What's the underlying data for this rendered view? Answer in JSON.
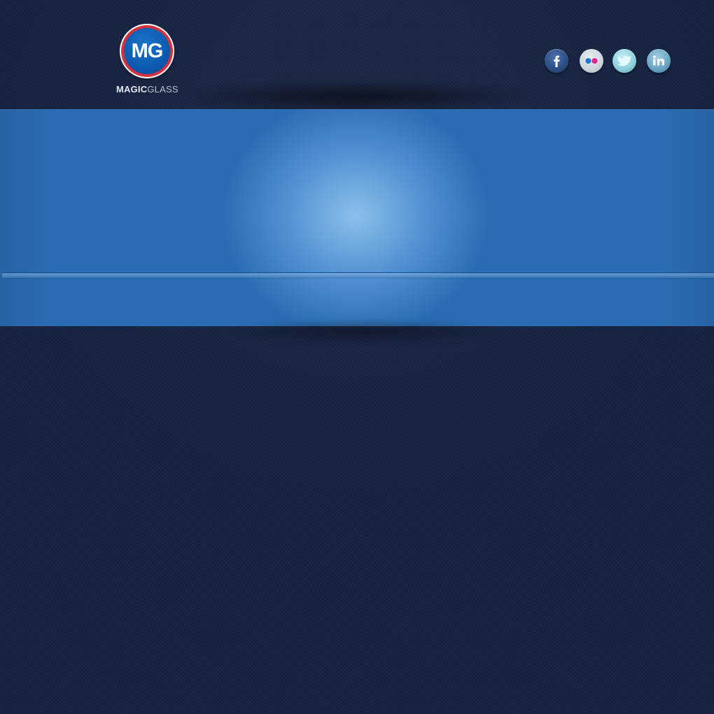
{
  "brand": {
    "logo_initials": "MG",
    "logo_bold_text": "MAGIC",
    "logo_light_text": "GLASS",
    "logo_blue": "#0b58ad",
    "logo_red": "#d5303b"
  },
  "social": [
    {
      "name": "facebook",
      "icon": "facebook-icon"
    },
    {
      "name": "flickr",
      "icon": "flickr-icon"
    },
    {
      "name": "twitter",
      "icon": "twitter-icon"
    },
    {
      "name": "linkedin",
      "icon": "linkedin-icon"
    }
  ],
  "colors": {
    "page_background": "#14213f",
    "hero_background": "#2a6cb3",
    "hero_glow": "#8ec1ec"
  }
}
